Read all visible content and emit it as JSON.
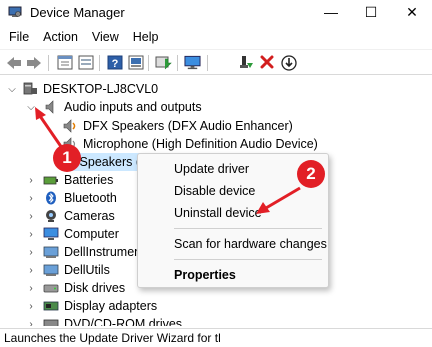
{
  "window": {
    "title": "Device Manager",
    "minimize_glyph": "—",
    "maximize_glyph": "☐",
    "close_glyph": "✕"
  },
  "menu": [
    "File",
    "Action",
    "View",
    "Help"
  ],
  "toolbar": {
    "icons": [
      "back-icon",
      "forward-icon",
      "properties-icon",
      "show-hide-icon",
      "help-icon",
      "update-driver-icon",
      "scan-hardware-icon",
      "monitor-icon",
      "enable-device-icon",
      "uninstall-icon",
      "download-icon"
    ]
  },
  "tree": {
    "root": "DESKTOP-LJ8CVL0",
    "category_audio": "Audio inputs and outputs",
    "audio_children": [
      "DFX Speakers (DFX Audio Enhancer)",
      "Microphone (High Definition Audio Device)",
      "Speakers ("
    ],
    "categories": [
      "Batteries",
      "Bluetooth",
      "Cameras",
      "Computer",
      "DellInstrumen",
      "DellUtils",
      "Disk drives",
      "Display adapters",
      "DVD/CD-ROM drives"
    ]
  },
  "context_menu": {
    "update": "Update driver",
    "disable": "Disable device",
    "uninstall": "Uninstall device",
    "scan": "Scan for hardware changes",
    "properties": "Properties"
  },
  "annotations": {
    "step1": "1",
    "step2": "2",
    "color": "#e21f26"
  },
  "status": {
    "text": "Launches the Update Driver Wizard for tl"
  }
}
